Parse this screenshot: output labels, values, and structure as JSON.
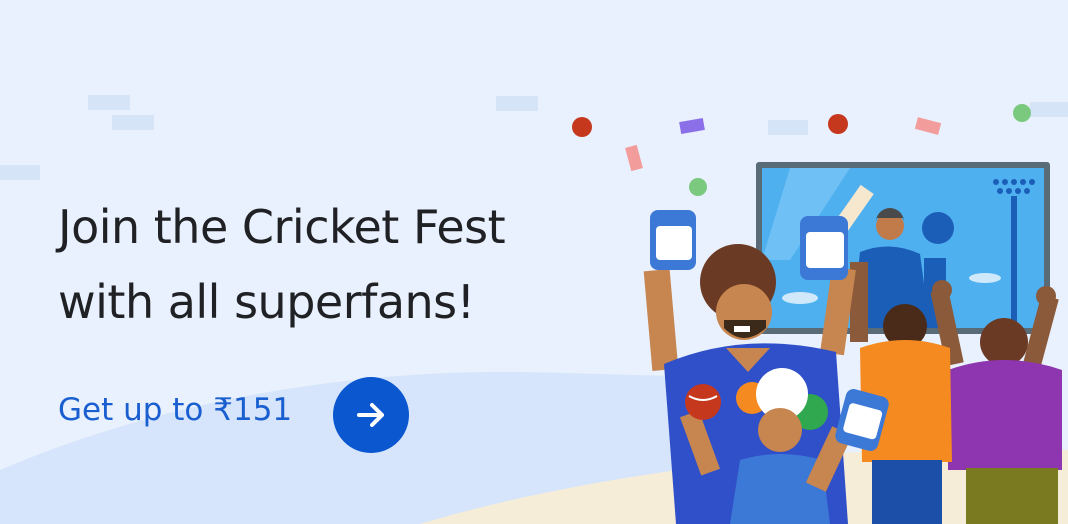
{
  "banner": {
    "headline_line1": "Join the Cricket Fest",
    "headline_line2": "with all superfans!",
    "cta_label": "Get up to ₹151",
    "cta_button_icon": "arrow-right-icon"
  },
  "colors": {
    "background": "#e8f1fd",
    "headline": "#202124",
    "cta_text": "#1a5fd0",
    "cta_button": "#0b57d0"
  }
}
